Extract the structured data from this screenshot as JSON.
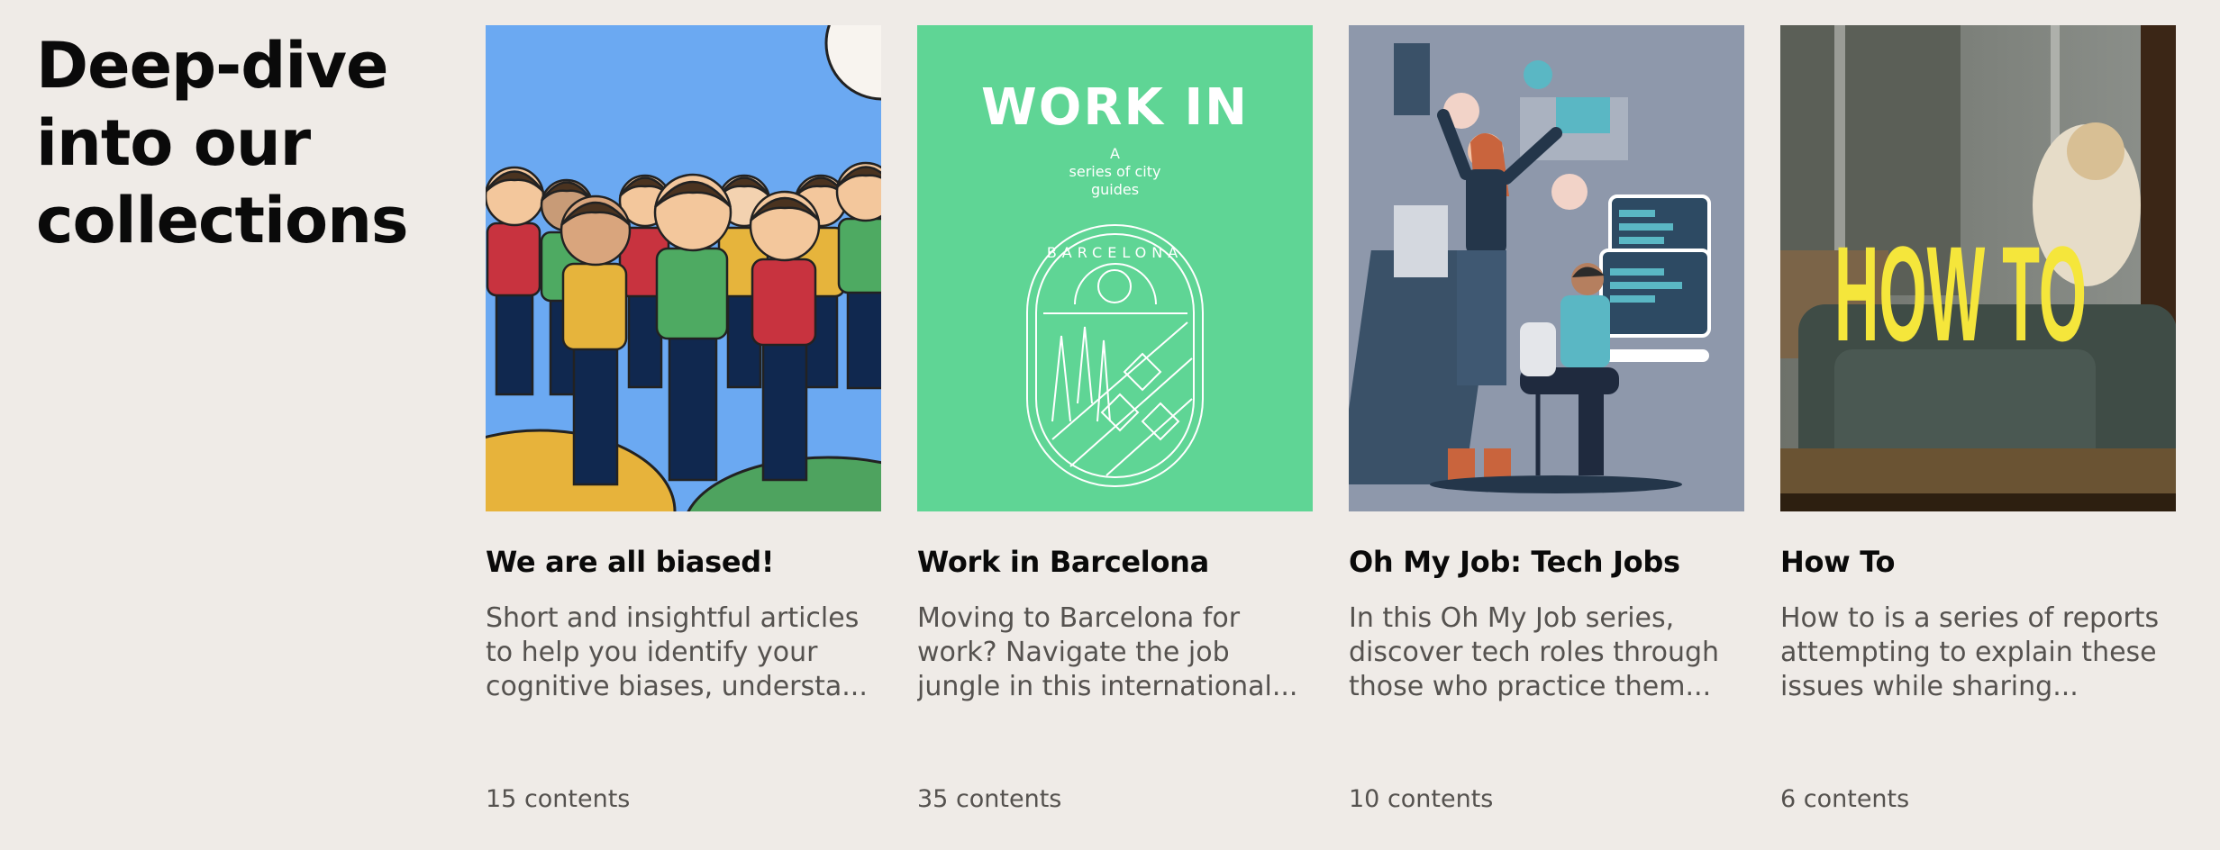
{
  "heading": {
    "lines": [
      "Deep-dive",
      "into our",
      "collections"
    ]
  },
  "collections": [
    {
      "title": "We are all biased!",
      "desc": [
        "Short and insightful articles",
        "to help you identify your",
        "cognitive biases, understa..."
      ],
      "count": "15 contents",
      "image": "illustration-group-of-people",
      "color": "#6ba9f2"
    },
    {
      "title": "Work in Barcelona",
      "desc": [
        "Moving to Barcelona for",
        "work? Navigate the job",
        "jungle in this international..."
      ],
      "count": "35 contents",
      "image": "work-in-barcelona-cover",
      "color": "#5fd595",
      "cover": {
        "brand": "WORK IN",
        "tagline": [
          "A",
          "series of city",
          "guides"
        ],
        "city": "BARCELONA"
      }
    },
    {
      "title": "Oh My Job: Tech Jobs",
      "desc": [
        "In this Oh My Job series,",
        "discover tech roles through",
        "those who practice them..."
      ],
      "count": "10 contents",
      "image": "illustration-tech-workers",
      "color": "#8e98ab"
    },
    {
      "title": "How To",
      "desc": [
        "How to is a series of reports",
        "attempting to explain these",
        "issues while sharing..."
      ],
      "count": "6 contents",
      "image": "photo-woman-on-sofa",
      "color": "#5b5f57",
      "cover": {
        "overlay": "HOW TO"
      }
    }
  ]
}
